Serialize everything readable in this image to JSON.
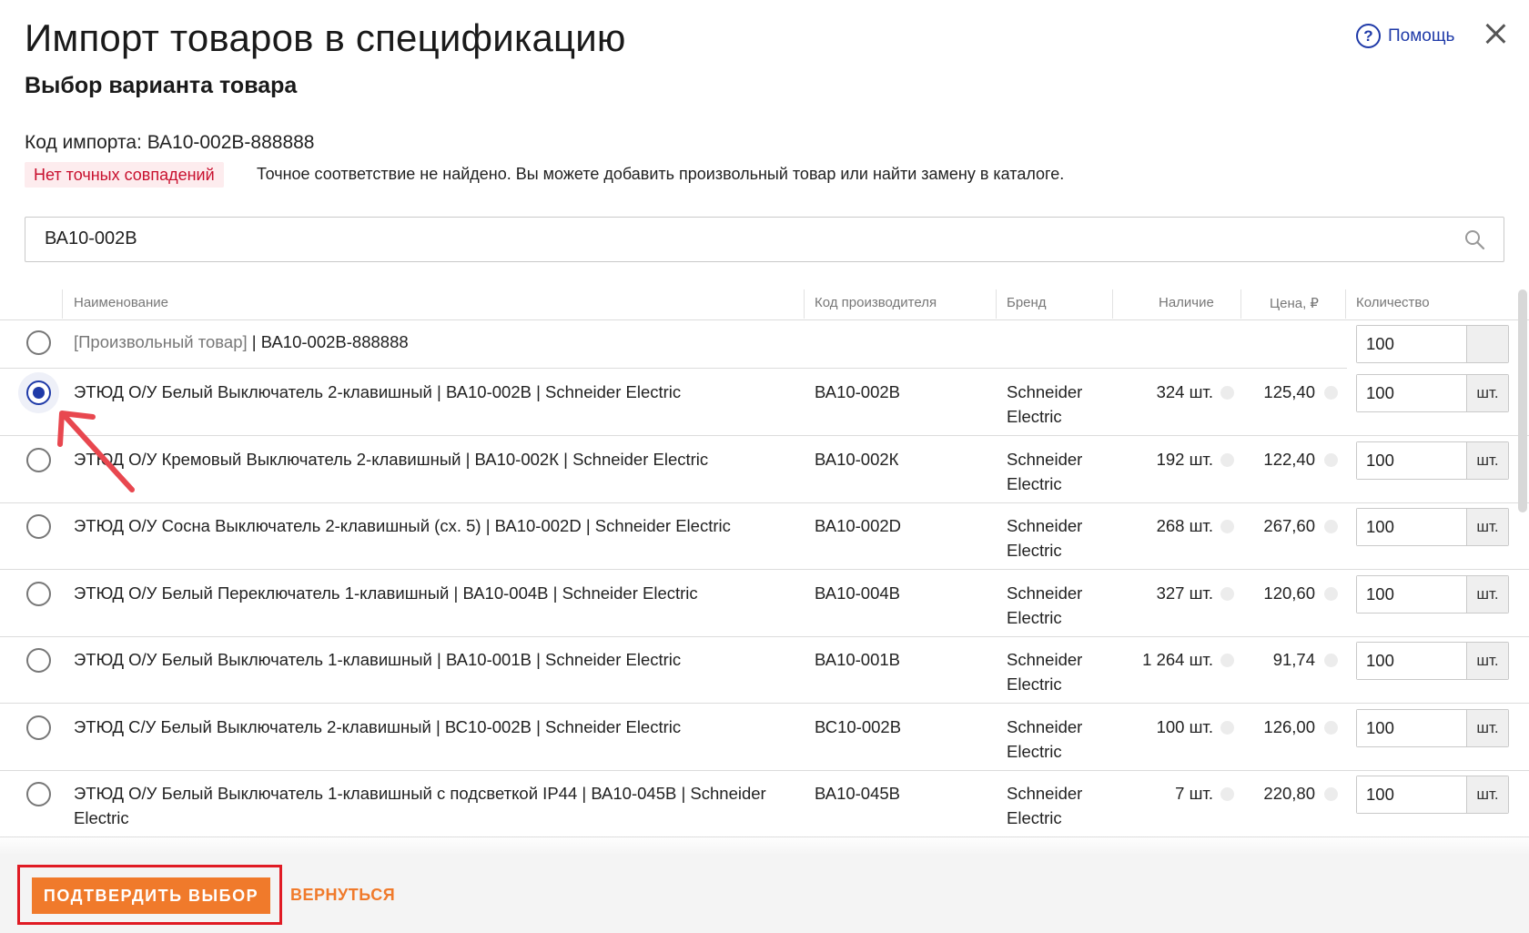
{
  "header": {
    "title": "Импорт товаров в спецификацию",
    "subtitle": "Выбор варианта товара",
    "help_label": "Помощь"
  },
  "import": {
    "code_label": "Код импорта: ВА10-002В-888888",
    "badge": "Нет точных совпадений",
    "notice": "Точное соответствие не найдено. Вы можете добавить произвольный товар или найти замену в каталоге."
  },
  "search": {
    "value": "ВА10-002В"
  },
  "table": {
    "headers": {
      "name": "Наименование",
      "code": "Код производителя",
      "brand": "Бренд",
      "stock": "Наличие",
      "price": "Цена, ₽",
      "qty": "Количество"
    },
    "custom_row": {
      "prefix": "[Произвольный товар]",
      "suffix": " | ВА10-002В-888888",
      "qty": "100"
    },
    "rows": [
      {
        "name": "ЭТЮД О/У Белый Выключатель 2-клавишный | ВА10-002В | Schneider Electric",
        "code": "ВА10-002В",
        "brand": "Schneider Electric",
        "stock": "324 шт.",
        "price": "125,40",
        "qty": "100",
        "unit": "шт.",
        "selected": true
      },
      {
        "name": "ЭТЮД О/У Кремовый Выключатель 2-клавишный | ВА10-002К | Schneider Electric",
        "code": "ВА10-002К",
        "brand": "Schneider Electric",
        "stock": "192 шт.",
        "price": "122,40",
        "qty": "100",
        "unit": "шт.",
        "selected": false
      },
      {
        "name": "ЭТЮД О/У Сосна Выключатель 2-клавишный (сх. 5) | ВА10-002D | Schneider Electric",
        "code": "ВА10-002D",
        "brand": "Schneider Electric",
        "stock": "268 шт.",
        "price": "267,60",
        "qty": "100",
        "unit": "шт.",
        "selected": false
      },
      {
        "name": "ЭТЮД О/У Белый Переключатель 1-клавишный | ВА10-004В | Schneider Electric",
        "code": "ВА10-004В",
        "brand": "Schneider Electric",
        "stock": "327 шт.",
        "price": "120,60",
        "qty": "100",
        "unit": "шт.",
        "selected": false
      },
      {
        "name": "ЭТЮД О/У Белый Выключатель 1-клавишный | ВА10-001В | Schneider Electric",
        "code": "ВА10-001В",
        "brand": "Schneider Electric",
        "stock": "1 264 шт.",
        "price": "91,74",
        "qty": "100",
        "unit": "шт.",
        "selected": false
      },
      {
        "name": "ЭТЮД С/У Белый Выключатель 2-клавишный | ВС10-002В | Schneider Electric",
        "code": "ВС10-002В",
        "brand": "Schneider Electric",
        "stock": "100 шт.",
        "price": "126,00",
        "qty": "100",
        "unit": "шт.",
        "selected": false
      },
      {
        "name": "ЭТЮД О/У Белый Выключатель 1-клавишный с подсветкой IP44 | ВА10-045В | Schneider Electric",
        "code": "ВА10-045В",
        "brand": "Schneider Electric",
        "stock": "7 шт.",
        "price": "220,80",
        "qty": "100",
        "unit": "шт.",
        "selected": false
      }
    ]
  },
  "footer": {
    "confirm_label": "ПОДТВЕРДИТЬ ВЫБОР",
    "back_label": "ВЕРНУТЬСЯ"
  },
  "colors": {
    "accent_blue": "#1f3aa8",
    "accent_orange": "#f07a2b",
    "badge_red": "#c8102e",
    "annotation_red": "#e01b24"
  }
}
